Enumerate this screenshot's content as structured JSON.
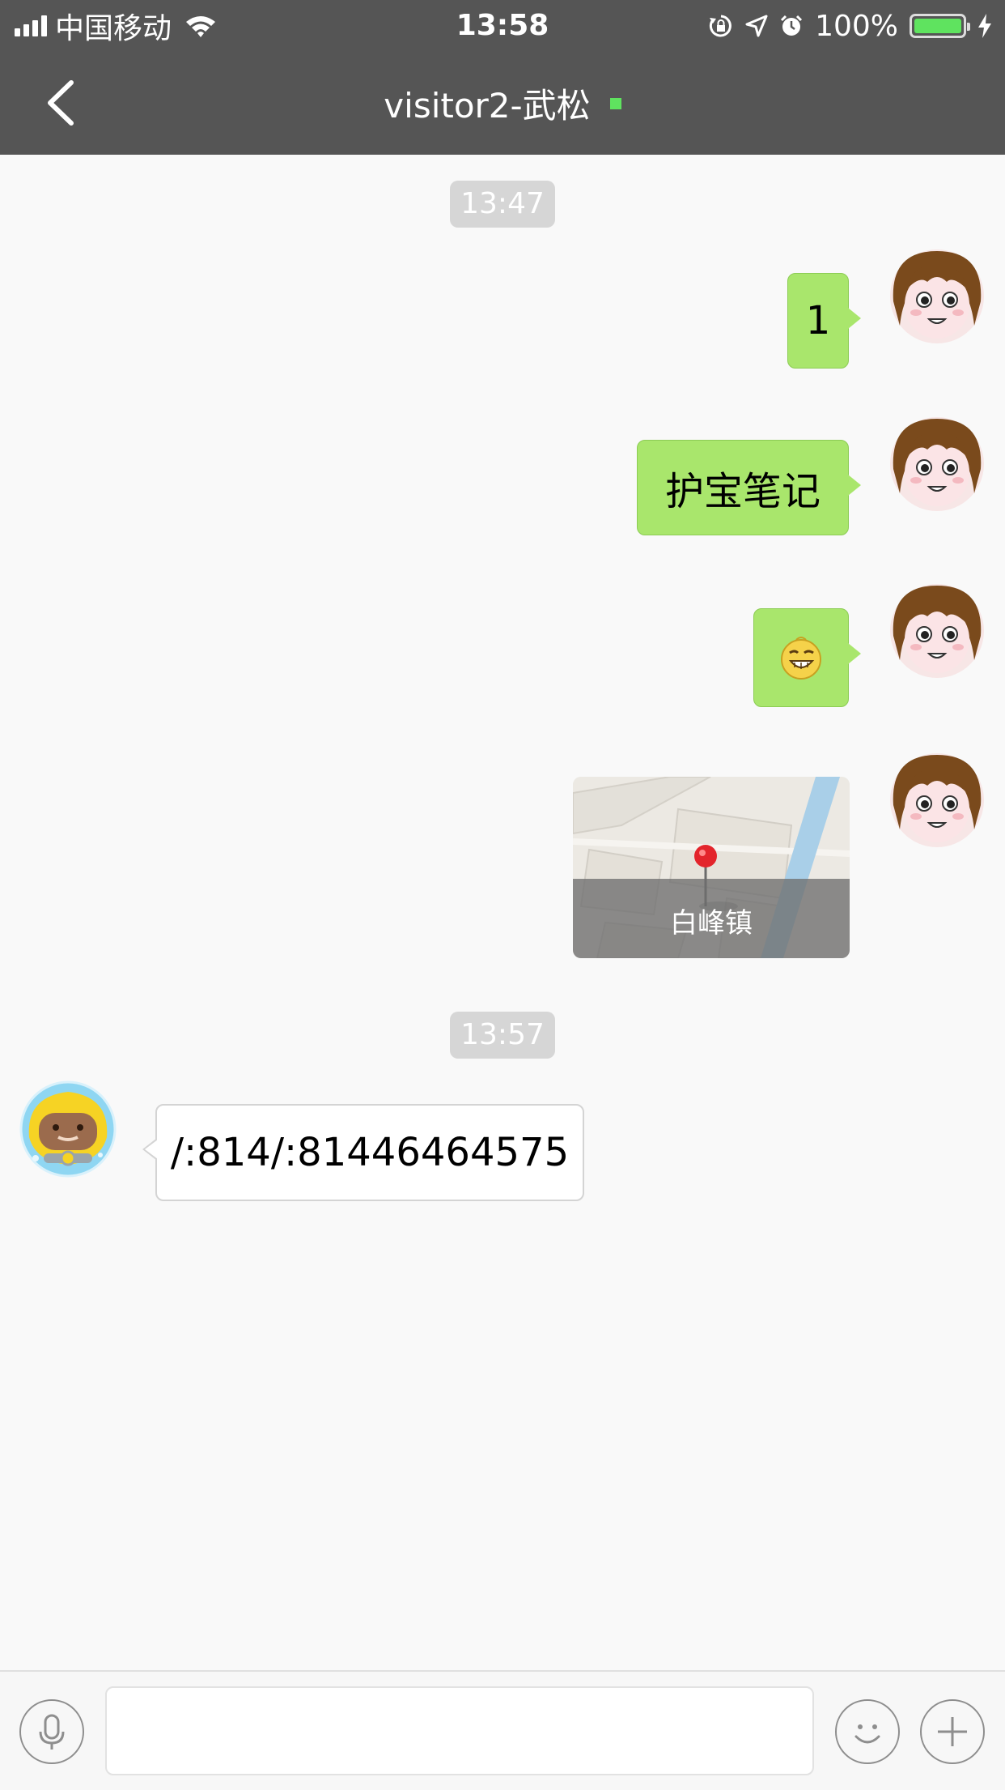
{
  "status_bar": {
    "carrier": "中国移动",
    "time": "13:58",
    "battery": "100%",
    "battery_level": 1.0,
    "icons": [
      "signal-icon",
      "wifi-icon",
      "rotation-lock-icon",
      "location-icon",
      "alarm-icon",
      "battery-icon",
      "charging-icon"
    ]
  },
  "nav": {
    "title": "visitor2-武松",
    "online_color": "#5fe35f"
  },
  "messages": {
    "time_1": "13:47",
    "msg_1": "1",
    "msg_2": "护宝笔记",
    "msg_3_icon": "grin-emoji-icon",
    "location_name": "白峰镇",
    "time_2": "13:57",
    "msg_5": "/:814/:81446464575"
  },
  "input": {
    "value": "",
    "placeholder": ""
  },
  "colors": {
    "header": "#555555",
    "sent_bubble": "#a9e66c",
    "background": "#f9f9f9"
  }
}
